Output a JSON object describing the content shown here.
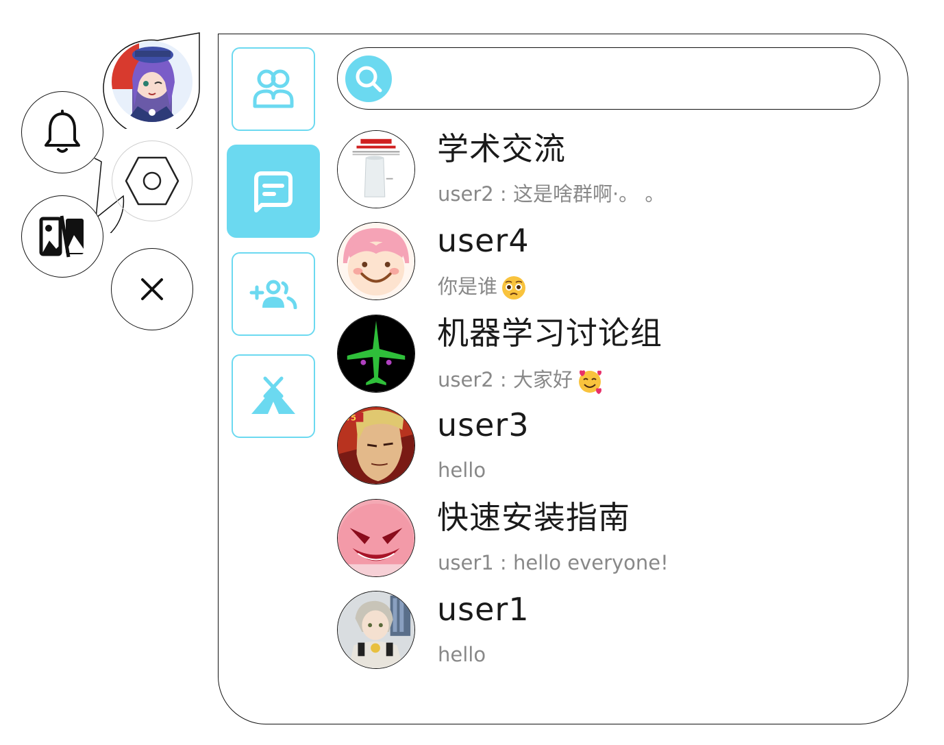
{
  "colors": {
    "accent": "#6bd9f0",
    "border": "#111111",
    "name_text": "#1a1a1a",
    "message_text": "#888888"
  },
  "left_controls": {
    "bell_icon": "bell-icon",
    "settings_icon": "hexagon-settings-icon",
    "gallery_icon": "image-toggle-icon",
    "close_icon": "close-icon"
  },
  "nav": {
    "items": [
      {
        "id": "friends",
        "icon": "contacts-icon",
        "active": false
      },
      {
        "id": "chats",
        "icon": "chat-bubble-icon",
        "active": true
      },
      {
        "id": "add",
        "icon": "add-friend-icon",
        "active": false
      },
      {
        "id": "discover",
        "icon": "tent-icon",
        "active": false
      }
    ]
  },
  "search": {
    "placeholder": "",
    "value": "",
    "icon": "search-icon"
  },
  "conversations": [
    {
      "name": "学术交流",
      "sender": "user2",
      "separator": " : ",
      "message": "这是啥群啊·。 。",
      "emoji": ""
    },
    {
      "name": "user4",
      "sender": "",
      "separator": "",
      "message": "你是谁",
      "emoji": "pleading-face"
    },
    {
      "name": "机器学习讨论组",
      "sender": "user2",
      "separator": " : ",
      "message": "大家好",
      "emoji": "smiling-face-with-hearts"
    },
    {
      "name": "user3",
      "sender": "",
      "separator": "",
      "message": "hello",
      "emoji": ""
    },
    {
      "name": "快速安装指南",
      "sender": "user1",
      "separator": " : ",
      "message": "hello everyone!",
      "emoji": ""
    },
    {
      "name": "user1",
      "sender": "",
      "separator": "",
      "message": "hello",
      "emoji": ""
    }
  ]
}
